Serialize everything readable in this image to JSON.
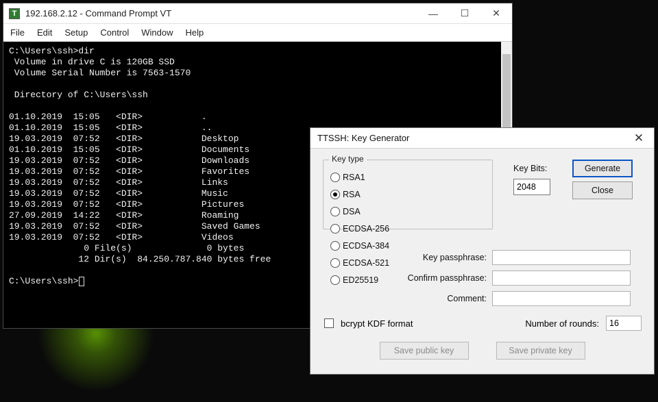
{
  "terminal": {
    "title": "192.168.2.12 - Command Prompt VT",
    "menu": [
      "File",
      "Edit",
      "Setup",
      "Control",
      "Window",
      "Help"
    ],
    "appicon_label": "T",
    "prompt": "C:\\Users\\ssh>",
    "cmd": "dir",
    "vol_line": " Volume in drive C is 120GB SSD",
    "serial_line": " Volume Serial Number is 7563-1570",
    "dirof": " Directory of C:\\Users\\ssh",
    "entries": [
      {
        "date": "01.10.2019",
        "time": "15:05",
        "type": "<DIR>",
        "name": "."
      },
      {
        "date": "01.10.2019",
        "time": "15:05",
        "type": "<DIR>",
        "name": ".."
      },
      {
        "date": "19.03.2019",
        "time": "07:52",
        "type": "<DIR>",
        "name": "Desktop"
      },
      {
        "date": "01.10.2019",
        "time": "15:05",
        "type": "<DIR>",
        "name": "Documents"
      },
      {
        "date": "19.03.2019",
        "time": "07:52",
        "type": "<DIR>",
        "name": "Downloads"
      },
      {
        "date": "19.03.2019",
        "time": "07:52",
        "type": "<DIR>",
        "name": "Favorites"
      },
      {
        "date": "19.03.2019",
        "time": "07:52",
        "type": "<DIR>",
        "name": "Links"
      },
      {
        "date": "19.03.2019",
        "time": "07:52",
        "type": "<DIR>",
        "name": "Music"
      },
      {
        "date": "19.03.2019",
        "time": "07:52",
        "type": "<DIR>",
        "name": "Pictures"
      },
      {
        "date": "27.09.2019",
        "time": "14:22",
        "type": "<DIR>",
        "name": "Roaming"
      },
      {
        "date": "19.03.2019",
        "time": "07:52",
        "type": "<DIR>",
        "name": "Saved Games"
      },
      {
        "date": "19.03.2019",
        "time": "07:52",
        "type": "<DIR>",
        "name": "Videos"
      }
    ],
    "summary1": "              0 File(s)              0 bytes",
    "summary2": "             12 Dir(s)  84.250.787.840 bytes free"
  },
  "dialog": {
    "title": "TTSSH: Key Generator",
    "group_label": "Key type",
    "radios": [
      {
        "label": "RSA1",
        "selected": false
      },
      {
        "label": "RSA",
        "selected": true
      },
      {
        "label": "DSA",
        "selected": false
      },
      {
        "label": "ECDSA-256",
        "selected": false
      },
      {
        "label": "ECDSA-384",
        "selected": false
      },
      {
        "label": "ECDSA-521",
        "selected": false
      },
      {
        "label": "ED25519",
        "selected": false
      }
    ],
    "keybits_label": "Key Bits:",
    "keybits_value": "2048",
    "btn_generate": "Generate",
    "btn_close": "Close",
    "lbl_passphrase": "Key passphrase:",
    "lbl_confirm": "Confirm passphrase:",
    "lbl_comment": "Comment:",
    "val_passphrase": "",
    "val_confirm": "",
    "val_comment": "",
    "bcrypt_label": "bcrypt KDF format",
    "bcrypt_checked": false,
    "rounds_label": "Number of rounds:",
    "rounds_value": "16",
    "btn_save_pub": "Save public key",
    "btn_save_priv": "Save private key"
  }
}
